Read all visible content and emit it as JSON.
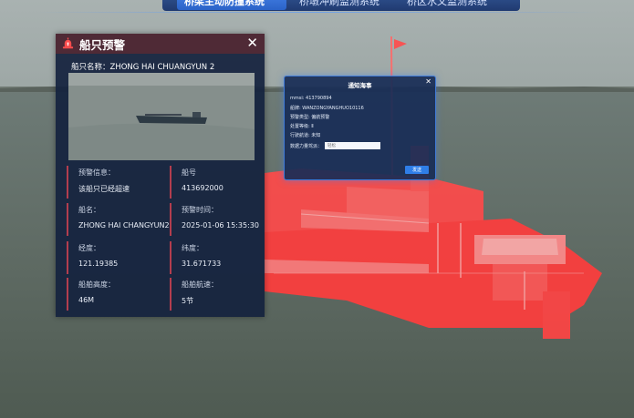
{
  "nav": {
    "tabs": [
      {
        "label": "桥梁主动防撞系统",
        "active": true
      },
      {
        "label": "桥墩冲刷监测系统",
        "active": false
      },
      {
        "label": "桥区水文监测系统",
        "active": false
      }
    ]
  },
  "warning_panel": {
    "title": "船只预警",
    "ship_name_label": "船只名称：ZHONG HAI CHUANGYUN 2",
    "fields": [
      {
        "label": "预警信息：",
        "value": "该船只已经超速"
      },
      {
        "label": "船号",
        "value": "413692000"
      },
      {
        "label": "船名：",
        "value": "ZHONG HAI CHANGYUN2"
      },
      {
        "label": "预警时间：",
        "value": "2025-01-06 15:35:30"
      },
      {
        "label": "经度：",
        "value": "121.19385"
      },
      {
        "label": "纬度：",
        "value": "31.671733"
      },
      {
        "label": "船舶高度：",
        "value": "46M"
      },
      {
        "label": "船舶航速：",
        "value": "5节"
      }
    ]
  },
  "notify_dialog": {
    "title": "通知海事",
    "rows": [
      "mmsi: 413790894",
      "船牌: WANZONGYANGHUO10116",
      "预警类型: 偏航预警",
      "处置等级: Ⅱ",
      "行驶航道: 未知"
    ],
    "input_label": "数据力量驾派：",
    "input_placeholder": "轻松",
    "send_label": "发送"
  },
  "colors": {
    "panel_header": "#4f2a36",
    "panel_body": "#14223e",
    "accent_red": "#b33d4e",
    "dialog_border": "#3f79d6",
    "button_blue": "#2f7ee8",
    "ship_highlight": "#ff4a4a"
  }
}
